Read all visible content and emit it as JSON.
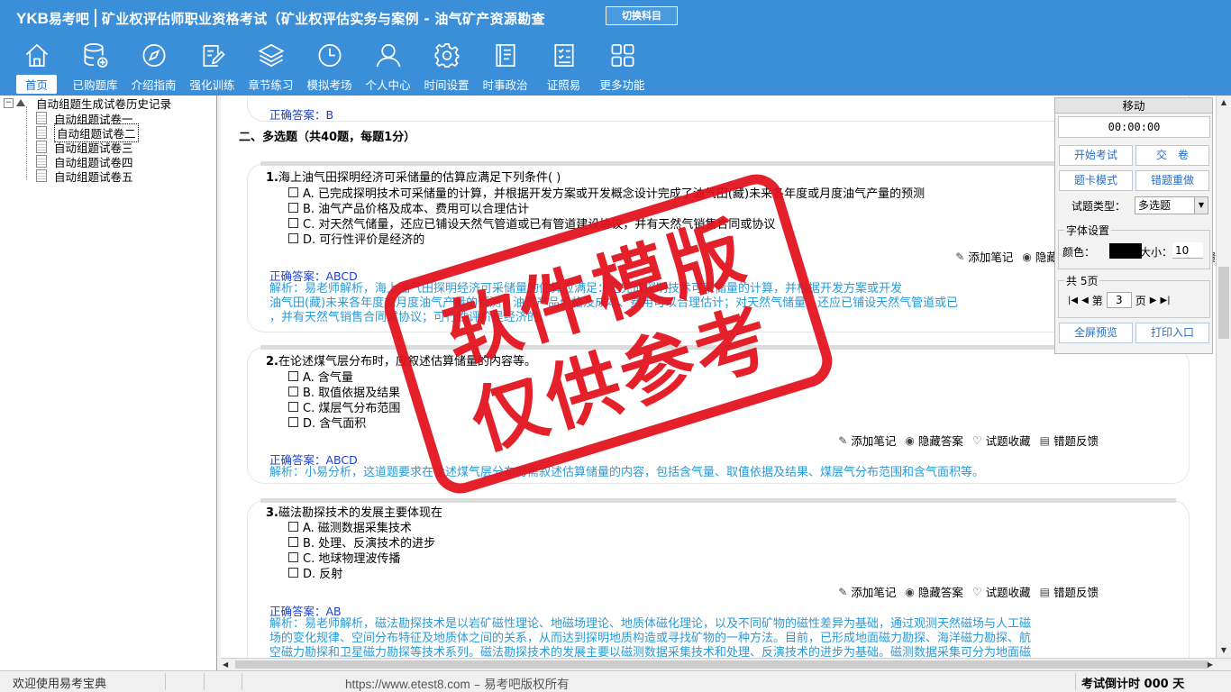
{
  "header": {
    "logo_latin": "YKB",
    "logo_cn": "易考吧",
    "subject": "矿业权评估师职业资格考试（矿业权评估实务与案例 - 油气矿产资源勘查",
    "switch_label": "切换科目"
  },
  "nav": [
    {
      "label": "首页",
      "icon": "home-icon"
    },
    {
      "label": "已购题库",
      "icon": "database-icon"
    },
    {
      "label": "介绍指南",
      "icon": "compass-icon"
    },
    {
      "label": "强化训练",
      "icon": "edit-icon"
    },
    {
      "label": "章节练习",
      "icon": "layers-icon"
    },
    {
      "label": "模拟考场",
      "icon": "clock-icon"
    },
    {
      "label": "个人中心",
      "icon": "user-icon"
    },
    {
      "label": "时间设置",
      "icon": "gear-icon"
    },
    {
      "label": "时事政治",
      "icon": "book-icon"
    },
    {
      "label": "证照易",
      "icon": "checklist-icon"
    },
    {
      "label": "更多功能",
      "icon": "grid-icon"
    }
  ],
  "tree": {
    "root": "自动组题生成试卷历史记录",
    "items": [
      "自动组题试卷一",
      "自动组题试卷二",
      "自动组题试卷三",
      "自动组题试卷四",
      "自动组题试卷五"
    ]
  },
  "content": {
    "prev_answer": "正确答案：B",
    "section_title": "二、多选题（共40题，每题1分）",
    "questions": [
      {
        "number": "1.",
        "text": "海上油气田探明经济可采储量的估算应满足下列条件( )",
        "options": [
          "A. 已完成探明技术可采储量的计算，并根据开发方案或开发概念设计完成了油气田(藏)未来各年度或月度油气产量的预测",
          "B. 油气产品价格及成本、费用可以合理估计",
          "C. 对天然气储量，还应已铺设天然气管道或已有管道建设协议，并有天然气销售合同或协议",
          "D. 可行性评价是经济的"
        ],
        "answer": "正确答案：ABCD",
        "explanation": [
          "解析：易老师解析，海上油气田探明经济可采储量的估算应满足：已完成探明技术可采储量的计算，并根据开发方案或开发",
          "油气田(藏)未来各年度或月度油气产量的预测；油气产品价格及成本、费用可以合理估计；对天然气储量，还应已铺设天然气管道或已",
          "，并有天然气销售合同或协议；可行性评价是经济的。"
        ]
      },
      {
        "number": "2.",
        "text": "在论述煤气层分布时，应叙述估算储量的内容等。",
        "options": [
          "A. 含气量",
          "B. 取值依据及结果",
          "C. 煤层气分布范围",
          "D. 含气面积"
        ],
        "answer": "正确答案：ABCD",
        "explanation": [
          "解析：小易分析，这道题要求在论述煤气层分布时需叙述估算储量的内容，包括含气量、取值依据及结果、煤层气分布范围和含气面积等。"
        ]
      },
      {
        "number": "3.",
        "text": "磁法勘探技术的发展主要体现在",
        "options": [
          "A. 磁测数据采集技术",
          "B. 处理、反演技术的进步",
          "C. 地球物理波传播",
          "D. 反射"
        ],
        "answer": "正确答案：AB",
        "explanation": [
          "解析：易老师解析，磁法勘探技术是以岩矿磁性理论、地磁场理论、地质体磁化理论，以及不同矿物的磁性差异为基础，通过观测天然磁场与人工磁",
          "场的变化规律、空间分布特征及地质体之间的关系，从而达到探明地质构造或寻找矿物的一种方法。目前，已形成地面磁力勘探、海洋磁力勘探、航",
          "空磁力勘探和卫星磁力勘探等技术系列。磁法勘探技术的发展主要以磁测数据采集技术和处理、反演技术的进步为基础。磁测数据采集可分为地面磁"
        ]
      }
    ],
    "actions": {
      "note": "添加笔记",
      "hide": "隐藏答案",
      "fav": "试题收藏",
      "report": "错题反馈"
    }
  },
  "panel": {
    "title": "移动",
    "timer": "00:00:00",
    "start": "开始考试",
    "submit": "交　卷",
    "card_mode": "题卡模式",
    "redo_wrong": "错题重做",
    "type_label": "试题类型：",
    "type_value": "多选题",
    "font_legend": "字体设置",
    "color_label": "颜色：",
    "color_value": "#000000",
    "size_label": "大小：",
    "size_value": "10",
    "pages_legend": "共 5页",
    "page_prefix": "第",
    "page_value": "3",
    "page_suffix": "页",
    "fullscreen": "全屏预览",
    "print": "打印入口"
  },
  "stamp": {
    "line1": "软件模版",
    "line2": "仅供参考"
  },
  "statusbar": {
    "welcome": "欢迎使用易考宝典",
    "url": "https://www.etest8.com",
    "copyright": " – 易考吧版权所有",
    "countdown": "考试倒计时 000 天"
  }
}
